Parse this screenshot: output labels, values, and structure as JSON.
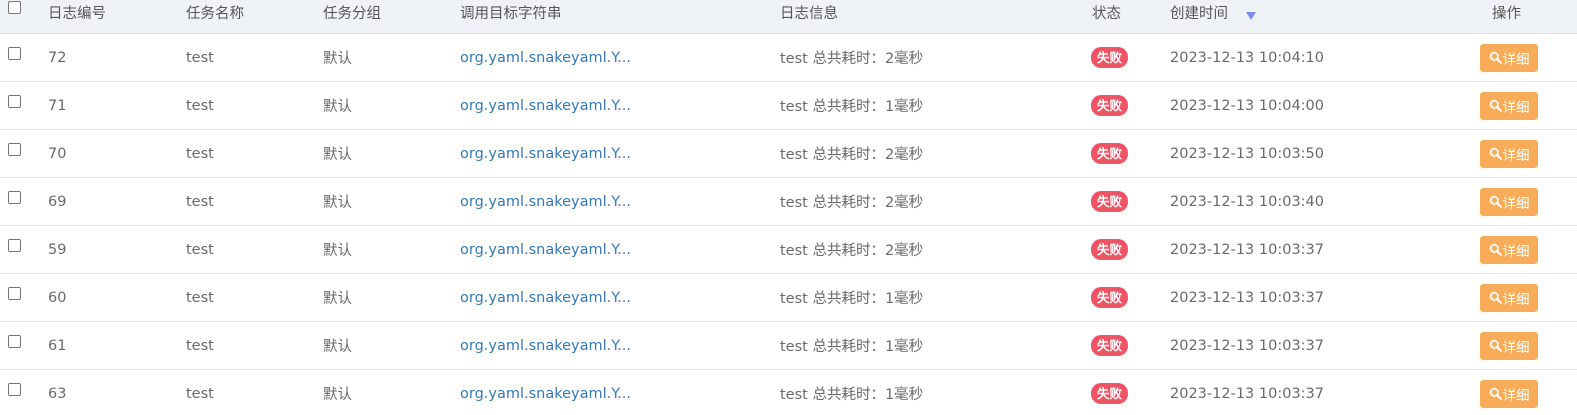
{
  "columns": {
    "id": "日志编号",
    "name": "任务名称",
    "group": "任务分组",
    "target": "调用目标字符串",
    "message": "日志信息",
    "status": "状态",
    "time": "创建时间",
    "action": "操作"
  },
  "sort_icon": "sort-desc-arrow",
  "status_color": "#ed5565",
  "button_color": "#f8ac59",
  "link_color": "#337ab7",
  "rows": [
    {
      "id": "72",
      "name": "test",
      "group": "默认",
      "target": "org.yaml.snakeyaml.Y...",
      "message": "test 总共耗时：2毫秒",
      "status": "失败",
      "time": "2023-12-13 10:04:10",
      "action": "详细"
    },
    {
      "id": "71",
      "name": "test",
      "group": "默认",
      "target": "org.yaml.snakeyaml.Y...",
      "message": "test 总共耗时：1毫秒",
      "status": "失败",
      "time": "2023-12-13 10:04:00",
      "action": "详细"
    },
    {
      "id": "70",
      "name": "test",
      "group": "默认",
      "target": "org.yaml.snakeyaml.Y...",
      "message": "test 总共耗时：2毫秒",
      "status": "失败",
      "time": "2023-12-13 10:03:50",
      "action": "详细"
    },
    {
      "id": "69",
      "name": "test",
      "group": "默认",
      "target": "org.yaml.snakeyaml.Y...",
      "message": "test 总共耗时：2毫秒",
      "status": "失败",
      "time": "2023-12-13 10:03:40",
      "action": "详细"
    },
    {
      "id": "59",
      "name": "test",
      "group": "默认",
      "target": "org.yaml.snakeyaml.Y...",
      "message": "test 总共耗时：2毫秒",
      "status": "失败",
      "time": "2023-12-13 10:03:37",
      "action": "详细"
    },
    {
      "id": "60",
      "name": "test",
      "group": "默认",
      "target": "org.yaml.snakeyaml.Y...",
      "message": "test 总共耗时：1毫秒",
      "status": "失败",
      "time": "2023-12-13 10:03:37",
      "action": "详细"
    },
    {
      "id": "61",
      "name": "test",
      "group": "默认",
      "target": "org.yaml.snakeyaml.Y...",
      "message": "test 总共耗时：1毫秒",
      "status": "失败",
      "time": "2023-12-13 10:03:37",
      "action": "详细"
    },
    {
      "id": "63",
      "name": "test",
      "group": "默认",
      "target": "org.yaml.snakeyaml.Y...",
      "message": "test 总共耗时：1毫秒",
      "status": "失败",
      "time": "2023-12-13 10:03:37",
      "action": "详细"
    }
  ]
}
